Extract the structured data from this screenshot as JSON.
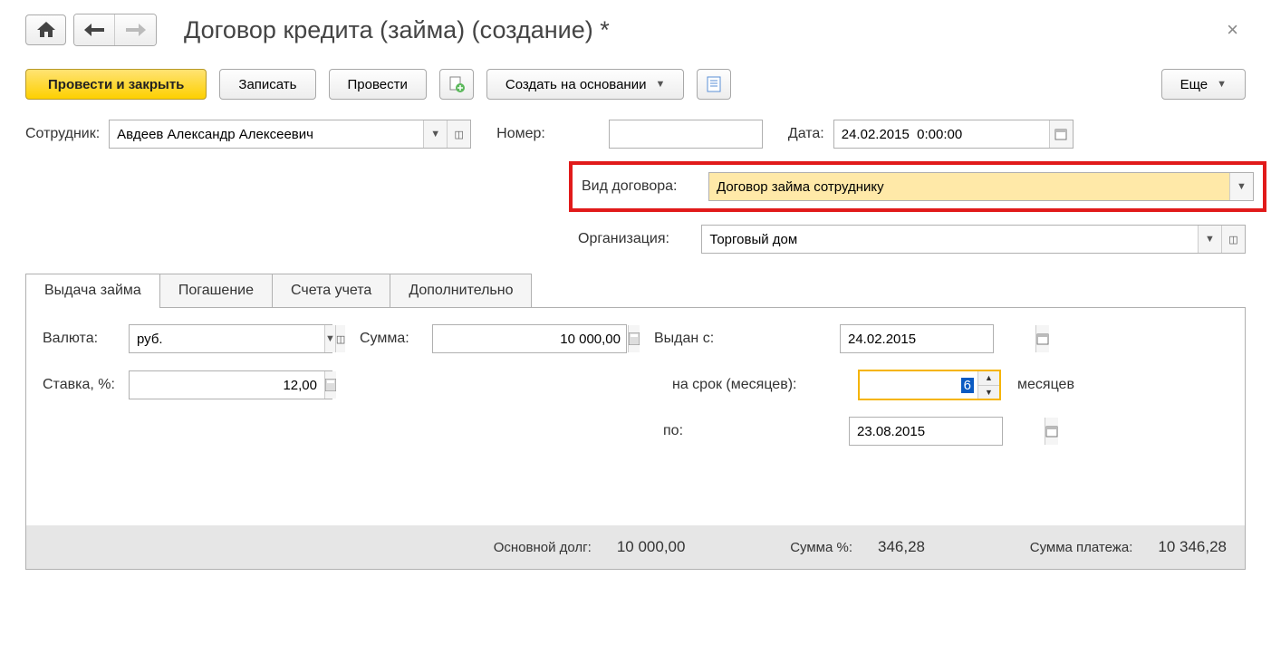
{
  "title": "Договор кредита (займа) (создание) *",
  "toolbar": {
    "post_close": "Провести и закрыть",
    "save": "Записать",
    "post": "Провести",
    "create_based": "Создать на основании",
    "more": "Еще"
  },
  "fields": {
    "employee_label": "Сотрудник:",
    "employee_value": "Авдеев Александр Алексеевич",
    "number_label": "Номер:",
    "number_value": "",
    "date_label": "Дата:",
    "date_value": "24.02.2015  0:00:00",
    "contract_type_label": "Вид договора:",
    "contract_type_value": "Договор займа сотруднику",
    "org_label": "Организация:",
    "org_value": "Торговый дом"
  },
  "tabs": {
    "issue": "Выдача займа",
    "repay": "Погашение",
    "accounts": "Счета учета",
    "extra": "Дополнительно"
  },
  "issue": {
    "currency_label": "Валюта:",
    "currency_value": "руб.",
    "amount_label": "Сумма:",
    "amount_value": "10 000,00",
    "rate_label": "Ставка, %:",
    "rate_value": "12,00",
    "from_label": "Выдан с:",
    "from_value": "24.02.2015",
    "term_label": "на срок (месяцев):",
    "term_value": "6",
    "term_unit": "месяцев",
    "to_label": "по:",
    "to_value": "23.08.2015"
  },
  "summary": {
    "principal_label": "Основной долг:",
    "principal_value": "10 000,00",
    "percent_label": "Сумма %:",
    "percent_value": "346,28",
    "payment_label": "Сумма платежа:",
    "payment_value": "10 346,28"
  }
}
